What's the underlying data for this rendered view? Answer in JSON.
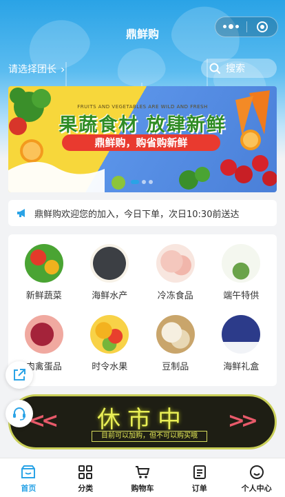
{
  "app": {
    "title": "鼎鲜购"
  },
  "header": {
    "group_select_label": "请选择团长",
    "search_label": "搜索"
  },
  "banner": {
    "small_text": "FRUITS AND VEGETABLES ARE WILD AND FRESH",
    "title": "果蔬食材 放肆新鲜",
    "pill_text": "鼎鲜购，购省购新鲜"
  },
  "notice": {
    "text": "鼎鲜购欢迎您的加入，今日下单，次日10:30前送达"
  },
  "categories": [
    {
      "label": "新鲜蔬菜",
      "icon": "vegetables-photo"
    },
    {
      "label": "海鲜水产",
      "icon": "seafood-photo"
    },
    {
      "label": "冷冻食品",
      "icon": "frozen-food-photo"
    },
    {
      "label": "端午特供",
      "icon": "dragon-boat-photo"
    },
    {
      "label": "肉禽蛋品",
      "icon": "meat-photo"
    },
    {
      "label": "时令水果",
      "icon": "fruit-photo"
    },
    {
      "label": "豆制品",
      "icon": "tofu-photo"
    },
    {
      "label": "海鲜礼盒",
      "icon": "gift-box-photo"
    }
  ],
  "rest_banner": {
    "title": "休市中",
    "subtitle": "目前可以加购，但不可以购买哦"
  },
  "tabs": [
    {
      "label": "首页",
      "icon": "home-icon",
      "active": true
    },
    {
      "label": "分类",
      "icon": "category-icon",
      "active": false
    },
    {
      "label": "购物车",
      "icon": "cart-icon",
      "active": false
    },
    {
      "label": "订单",
      "icon": "order-icon",
      "active": false
    },
    {
      "label": "个人中心",
      "icon": "profile-icon",
      "active": false
    }
  ],
  "colors": {
    "accent": "#2aa3e6",
    "banner_green": "#2f8c24",
    "banner_red": "#e93a2f",
    "neon": "#e9ef56"
  }
}
